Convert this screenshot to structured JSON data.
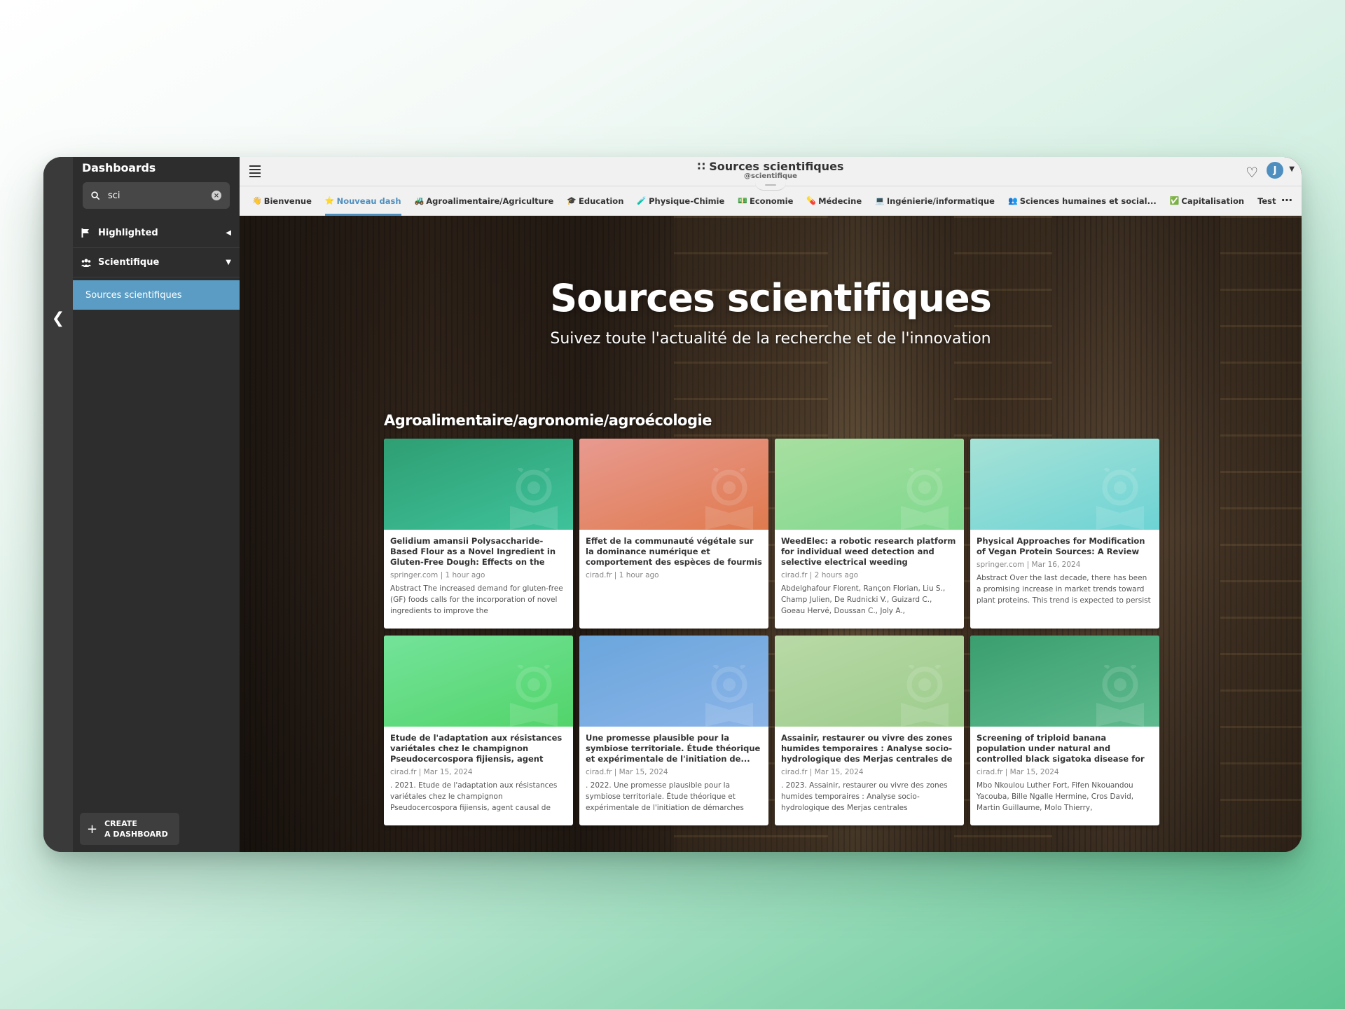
{
  "sidebar": {
    "title": "Dashboards",
    "search_value": "sci",
    "sections": [
      {
        "label": "Highlighted",
        "icon": "flag-icon"
      },
      {
        "label": "Scientifique",
        "icon": "users-icon"
      }
    ],
    "active_item": "Sources scientifiques",
    "create_line1": "CREATE",
    "create_line2": "A DASHBOARD"
  },
  "header": {
    "title": "Sources scientifiques",
    "handle": "@scientifique",
    "avatar_letter": "J"
  },
  "tabs": [
    {
      "emoji": "👋",
      "label": "Bienvenue"
    },
    {
      "emoji": "⭐",
      "label": "Nouveau dash",
      "active": true
    },
    {
      "emoji": "🚜",
      "label": "Agroalimentaire/Agriculture"
    },
    {
      "emoji": "🎓",
      "label": "Education"
    },
    {
      "emoji": "🧪",
      "label": "Physique-Chimie"
    },
    {
      "emoji": "💵",
      "label": "Economie"
    },
    {
      "emoji": "💊",
      "label": "Médecine"
    },
    {
      "emoji": "💻",
      "label": "Ingénierie/informatique"
    },
    {
      "emoji": "👥",
      "label": "Sciences humaines et social..."
    },
    {
      "emoji": "✅",
      "label": "Capitalisation"
    },
    {
      "emoji": "",
      "label": "Test"
    }
  ],
  "hero": {
    "title": "Sources scientifiques",
    "subtitle": "Suivez toute l'actualité de la recherche et de l'innovation"
  },
  "section_title": "Agroalimentaire/agronomie/agroécologie",
  "cards": [
    {
      "title": "Gelidium amansii Polysaccharide-Based Flour as a Novel Ingredient in Gluten-Free Dough: Effects on the Rheological...",
      "meta": "springer.com | 1 hour ago",
      "excerpt": "Abstract The increased demand for gluten-free (GF) foods calls for the incorporation of novel ingredients to improve the",
      "c1": "#2f9e73",
      "c2": "#3ec29a"
    },
    {
      "title": "Effet de la communauté végétale sur la dominance numérique et comportement des espèces de fourmis dans les...",
      "meta": "cirad.fr | 1 hour ago",
      "excerpt": "",
      "c1": "#e89a90",
      "c2": "#e07a4e"
    },
    {
      "title": "WeedElec: a robotic research platform for individual weed detection and selective electrical weeding",
      "meta": "cirad.fr | 2 hours ago",
      "excerpt": "Abdelghafour Florent, Rançon Florian, Liu S., Champ Julien, De Rudnicki V., Guizard C., Goeau Hervé, Doussan C., Joly A.,",
      "c1": "#a8dfa0",
      "c2": "#7fd88e"
    },
    {
      "title": "Physical Approaches for Modification of Vegan Protein Sources: A Review",
      "meta": "springer.com | Mar 16, 2024",
      "excerpt": "Abstract Over the last decade, there has been a promising increase in market trends toward plant proteins. This trend is expected to persist in coming years due to",
      "c1": "#a6e2d6",
      "c2": "#6dd3d5"
    },
    {
      "title": "Etude de l'adaptation aux résistances variétales chez le champignon Pseudocercospora fijiensis, agent caus...",
      "meta": "cirad.fr | Mar 15, 2024",
      "excerpt": ". 2021. Etude de l'adaptation aux résistances variétales chez le champignon Pseudocercospora fijiensis, agent causal de",
      "c1": "#74e39a",
      "c2": "#52d46a"
    },
    {
      "title": "Une promesse plausible pour la symbiose territoriale. Étude théorique et expérimentale de l'initiation de...",
      "meta": "cirad.fr | Mar 15, 2024",
      "excerpt": ". 2022. Une promesse plausible pour la symbiose territoriale. Étude théorique et expérimentale de l'initiation de démarches",
      "c1": "#6aa6dc",
      "c2": "#8bb4e8"
    },
    {
      "title": "Assainir, restaurer ou vivre des zones humides temporaires : Analyse socio-hydrologique des Merjas centrales de l...",
      "meta": "cirad.fr | Mar 15, 2024",
      "excerpt": ". 2023. Assainir, restaurer ou vivre des zones humides temporaires : Analyse socio-hydrologique des Merjas centrales",
      "c1": "#b9d9a6",
      "c2": "#9ccc8c"
    },
    {
      "title": "Screening of triploid banana population under natural and controlled black sigatoka disease for genomic selection",
      "meta": "cirad.fr | Mar 15, 2024",
      "excerpt": "Mbo Nkoulou Luther Fort, Fifen Nkouandou Yacouba, Bille Ngalle Hermine, Cros David, Martin Guillaume, Molo Thierry,",
      "c1": "#3a9e6e",
      "c2": "#5fbb8f"
    }
  ]
}
